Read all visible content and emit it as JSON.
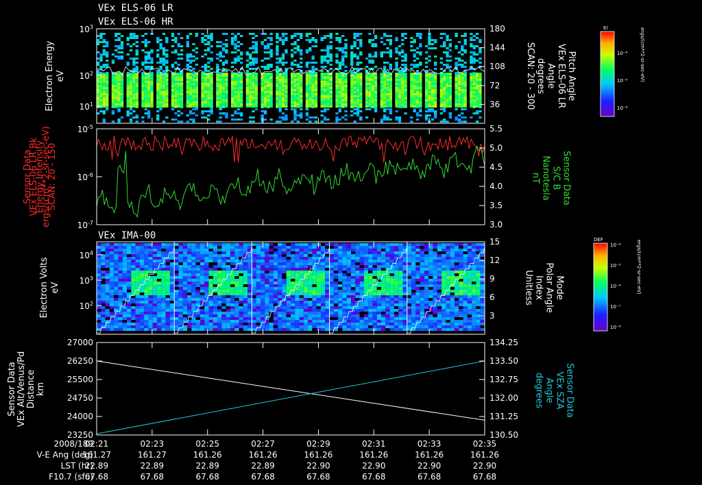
{
  "titles": {
    "line1": "VEx ELS-06 LR",
    "line2": "VEx ELS-06 HR",
    "ima": "VEx IMA-00"
  },
  "colors": {
    "red_series": "#ff2a2a",
    "green_series": "#33dd33",
    "cyan_series": "#22ccdd",
    "white": "#ffffff",
    "axes": "#ffffff"
  },
  "chart_data": [
    {
      "type": "heatmap",
      "name": "els-spectrogram",
      "title": "VEx ELS-06 LR",
      "left_label": [
        "Electron Energy",
        "eV"
      ],
      "right_label": [
        "Pitch Angle",
        "VEx ELS-06 LR",
        "Angle",
        "degrees",
        "SCAN: 20 - 300"
      ],
      "yticks_left": [
        {
          "base": "10",
          "exp": "1"
        },
        {
          "base": "10",
          "exp": "2"
        },
        {
          "base": "10",
          "exp": "3"
        }
      ],
      "yticks_right": [
        "36",
        "72",
        "108",
        "144",
        "180"
      ],
      "y_right_range": [
        0,
        180
      ],
      "colorbar": {
        "title": "El",
        "ticks": [
          "10⁻⁴",
          "10⁻⁵",
          "10⁻⁶"
        ],
        "label": "ergs/(cm**2-sr-sec-eV)"
      },
      "overlay_pitch_angle_deg_approx": 100
    },
    {
      "type": "line",
      "name": "intensity-and-field",
      "left_label": [
        "Sensor Data",
        "VEx ELS-06 LR Bk",
        "Energy Intensity",
        "ergs/(cm**2-sr-sec-eV)",
        "SCAN: 20 - 150"
      ],
      "right_label": [
        "Sensor Data",
        "S/C B",
        "Nanotesla",
        "nT"
      ],
      "yticks_left": [
        {
          "base": "10",
          "exp": "-7"
        },
        {
          "base": "10",
          "exp": "-6"
        },
        {
          "base": "10",
          "exp": "-5"
        }
      ],
      "y_left_range": [
        "1e-7",
        "1e-5"
      ],
      "yticks_right": [
        "3.0",
        "3.5",
        "4.0",
        "4.5",
        "5.0",
        "5.5"
      ],
      "y_right_range": [
        3.0,
        5.5
      ],
      "series": [
        {
          "axis": "left",
          "color": "red",
          "level_log10_approx": -5.3
        },
        {
          "axis": "right",
          "color": "green",
          "start_nT_approx": 3.5,
          "end_nT_approx": 4.7
        }
      ]
    },
    {
      "type": "heatmap",
      "name": "ima-spectrogram",
      "title": "VEx IMA-00",
      "left_label": [
        "Electron Volts",
        "eV"
      ],
      "right_label": [
        "Mode",
        "Polar Angle",
        "Index",
        "Unitless"
      ],
      "yticks_left": [
        {
          "base": "10",
          "exp": "2"
        },
        {
          "base": "10",
          "exp": "3"
        },
        {
          "base": "10",
          "exp": "4"
        }
      ],
      "yticks_right": [
        "3",
        "6",
        "9",
        "12",
        "15"
      ],
      "y_right_range": [
        0,
        15
      ],
      "colorbar": {
        "title": "DEF",
        "ticks": [
          "10⁻⁴",
          "10⁻⁵",
          "10⁻⁶",
          "10⁻⁷",
          "10⁻⁸"
        ],
        "label": "ergs/(cm**2-sr-sec-eV)"
      },
      "scan_cycles": 5
    },
    {
      "type": "line",
      "name": "distance-and-sza",
      "left_label": [
        "Sensor Data",
        "VEx Alt/Venus/Pd",
        "Distance",
        "km"
      ],
      "right_label": [
        "Sensor Data",
        "VEx SZA",
        "Angle",
        "degrees"
      ],
      "yticks_left": [
        "23250",
        "24000",
        "24750",
        "25500",
        "26250",
        "27000"
      ],
      "y_left_range": [
        23250,
        27000
      ],
      "yticks_right": [
        "130.50",
        "131.25",
        "132.00",
        "132.75",
        "133.50",
        "134.25"
      ],
      "y_right_range": [
        130.5,
        134.25
      ],
      "x_range": [
        "02:21",
        "02:35"
      ],
      "series": [
        {
          "axis": "left",
          "color": "white",
          "x": [
            "02:21",
            "02:35"
          ],
          "y": [
            26250,
            23850
          ]
        },
        {
          "axis": "right",
          "color": "cyan",
          "x": [
            "02:21",
            "02:35"
          ],
          "y": [
            130.55,
            133.5
          ]
        }
      ]
    }
  ],
  "xaxis": {
    "ticks": [
      "02:21",
      "02:23",
      "02:25",
      "02:27",
      "02:29",
      "02:31",
      "02:33",
      "02:35"
    ],
    "rows": [
      {
        "label": "2008/189",
        "values": [
          "02:21",
          "02:23",
          "02:25",
          "02:27",
          "02:29",
          "02:31",
          "02:33",
          "02:35"
        ]
      },
      {
        "label": "V-E Ang (deg)",
        "values": [
          "161.27",
          "161.27",
          "161.26",
          "161.26",
          "161.26",
          "161.26",
          "161.26",
          "161.26"
        ]
      },
      {
        "label": "LST (hr)",
        "values": [
          "22.89",
          "22.89",
          "22.89",
          "22.89",
          "22.90",
          "22.90",
          "22.90",
          "22.90"
        ]
      },
      {
        "label": "F10.7 (sfu)",
        "values": [
          "67.68",
          "67.68",
          "67.68",
          "67.68",
          "67.68",
          "67.68",
          "67.68",
          "67.68"
        ]
      }
    ]
  }
}
